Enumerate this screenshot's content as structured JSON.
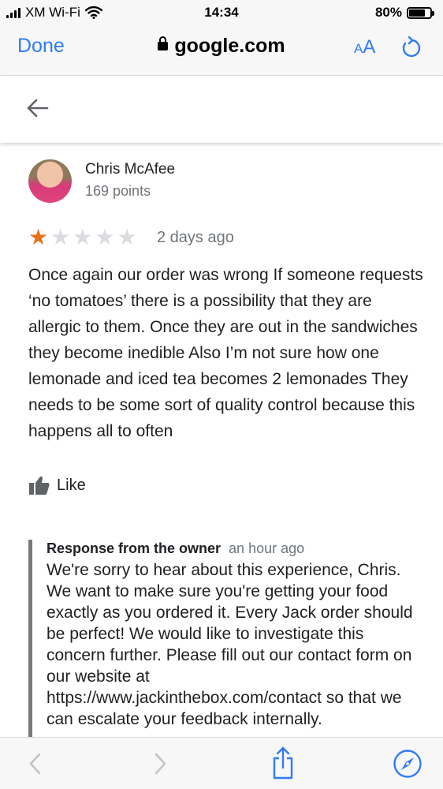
{
  "status_bar": {
    "carrier": "XM Wi-Fi",
    "time": "14:34",
    "battery_percent": "80%",
    "battery_level": 0.8
  },
  "browser": {
    "done_label": "Done",
    "url": "google.com",
    "text_size_small": "A",
    "text_size_large": "A",
    "accent_color": "#2f7cf6"
  },
  "review": {
    "reviewer_name": "Chris McAfee",
    "reviewer_points": "169 points",
    "rating": 1,
    "rating_max": 5,
    "date": "2 days ago",
    "text": "Once again our order was wrong If someone requests ‘no tomatoes’ there is a possibility that they are allergic to them. Once they are out in the sandwiches they become inedible Also I’m not sure how one lemonade and iced tea becomes 2 lemonades They needs to be some sort of quality control because this happens all to often",
    "like_label": "Like",
    "star_color": "#e7711b"
  },
  "owner_response": {
    "title": "Response from the owner",
    "time": "an hour ago",
    "text": "We're sorry to hear about this experience, Chris. We want to make sure you're getting your food exactly as you ordered it. Every Jack order should be perfect! We would like to investigate this concern further. Please fill out our contact form on our website at https://www.jackinthebox.com/contact so that we can escalate your feedback internally."
  },
  "icons": {
    "back": "arrow-left-icon",
    "like": "thumbs-up-icon",
    "share": "share-icon",
    "compass": "compass-icon",
    "reload": "reload-icon",
    "lock": "lock-icon"
  }
}
